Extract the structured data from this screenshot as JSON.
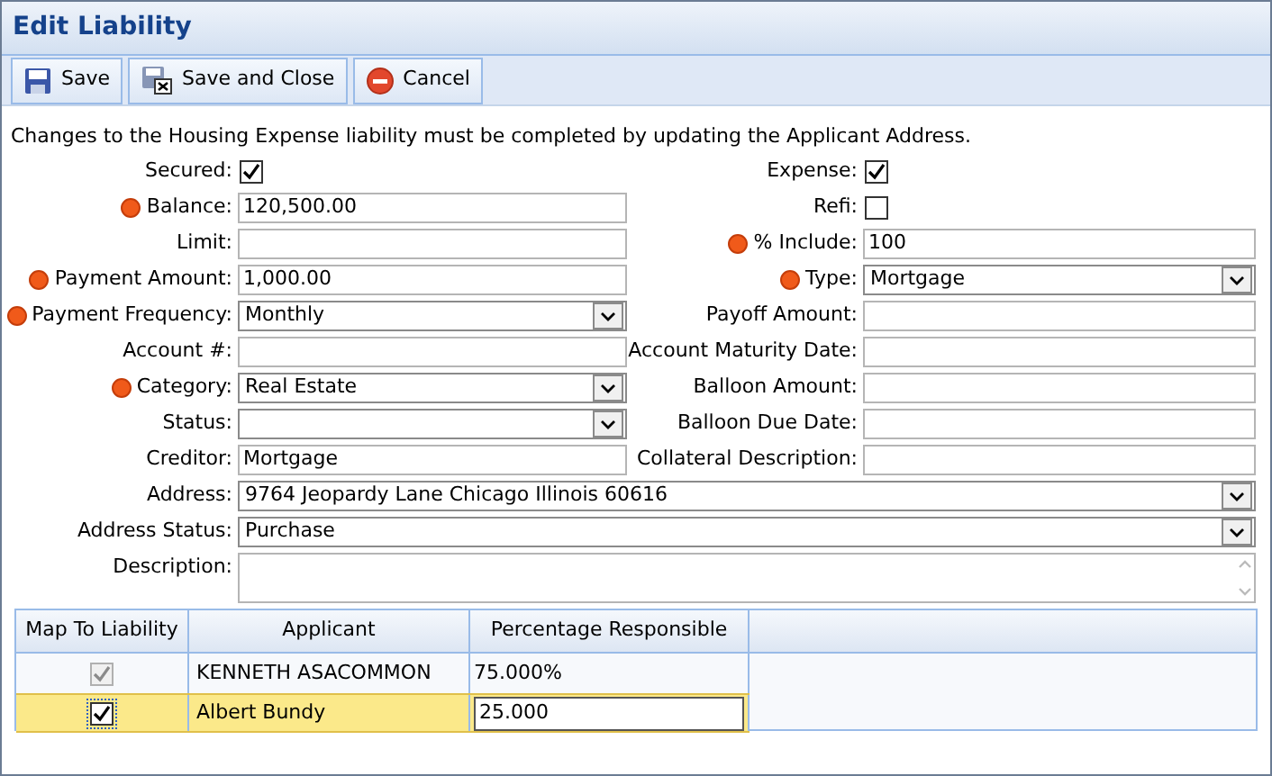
{
  "window": {
    "title": "Edit Liability"
  },
  "toolbar": [
    {
      "label": "Save",
      "kind": "save"
    },
    {
      "label": "Save and Close",
      "kind": "save-close"
    },
    {
      "label": "Cancel",
      "kind": "cancel"
    }
  ],
  "message": "Changes to the Housing Expense liability must be completed by updating the Applicant Address.",
  "form": {
    "left": [
      {
        "kind": "checkbox",
        "label": "Secured:",
        "required": false,
        "checked": true
      },
      {
        "kind": "text",
        "label": "Balance:",
        "required": true,
        "value": "120,500.00"
      },
      {
        "kind": "text",
        "label": "Limit:",
        "required": false
      },
      {
        "kind": "text",
        "label": "Payment Amount:",
        "required": true,
        "value": "1,000.00"
      },
      {
        "kind": "select",
        "label": "Payment Frequency:",
        "required": true,
        "value": "Monthly"
      },
      {
        "kind": "text",
        "label": "Account #:",
        "required": false
      },
      {
        "kind": "select",
        "label": "Category:",
        "required": true,
        "value": "Real Estate"
      },
      {
        "kind": "select",
        "label": "Status:",
        "required": false
      },
      {
        "kind": "text",
        "label": "Creditor:",
        "required": false,
        "value": "Mortgage"
      }
    ],
    "right": [
      {
        "kind": "checkbox",
        "label": "Expense:",
        "required": false,
        "checked": true
      },
      {
        "kind": "checkbox",
        "label": "Refi:",
        "required": false,
        "checked": false
      },
      {
        "kind": "text",
        "label": "% Include:",
        "required": true,
        "value": "100"
      },
      {
        "kind": "select",
        "label": "Type:",
        "required": true,
        "value": "Mortgage"
      },
      {
        "kind": "text",
        "label": "Payoff Amount:",
        "required": false
      },
      {
        "kind": "text",
        "label": "Account Maturity Date:",
        "required": false
      },
      {
        "kind": "text",
        "label": "Balloon Amount:",
        "required": false
      },
      {
        "kind": "text",
        "label": "Balloon Due Date:",
        "required": false
      },
      {
        "kind": "text",
        "label": "Collateral Description:",
        "required": false
      }
    ],
    "full": [
      {
        "kind": "select",
        "label": "Address:",
        "required": false,
        "value": "9764 Jeopardy Lane Chicago Illinois 60616"
      },
      {
        "kind": "select",
        "label": "Address Status:",
        "required": false,
        "value": "Purchase"
      },
      {
        "kind": "textarea",
        "label": "Description:",
        "required": false
      }
    ]
  },
  "grid": {
    "columns": [
      "Map To Liability",
      "Applicant",
      "Percentage Responsible"
    ],
    "rows": [
      {
        "checked": true,
        "disabled": true,
        "selected": false,
        "applicant": "KENNETH ASACOMMON",
        "percentage": "75.000%",
        "editing": false
      },
      {
        "checked": true,
        "disabled": false,
        "selected": true,
        "applicant": "Albert Bundy",
        "percentage": "25.000",
        "editing": true
      }
    ]
  }
}
